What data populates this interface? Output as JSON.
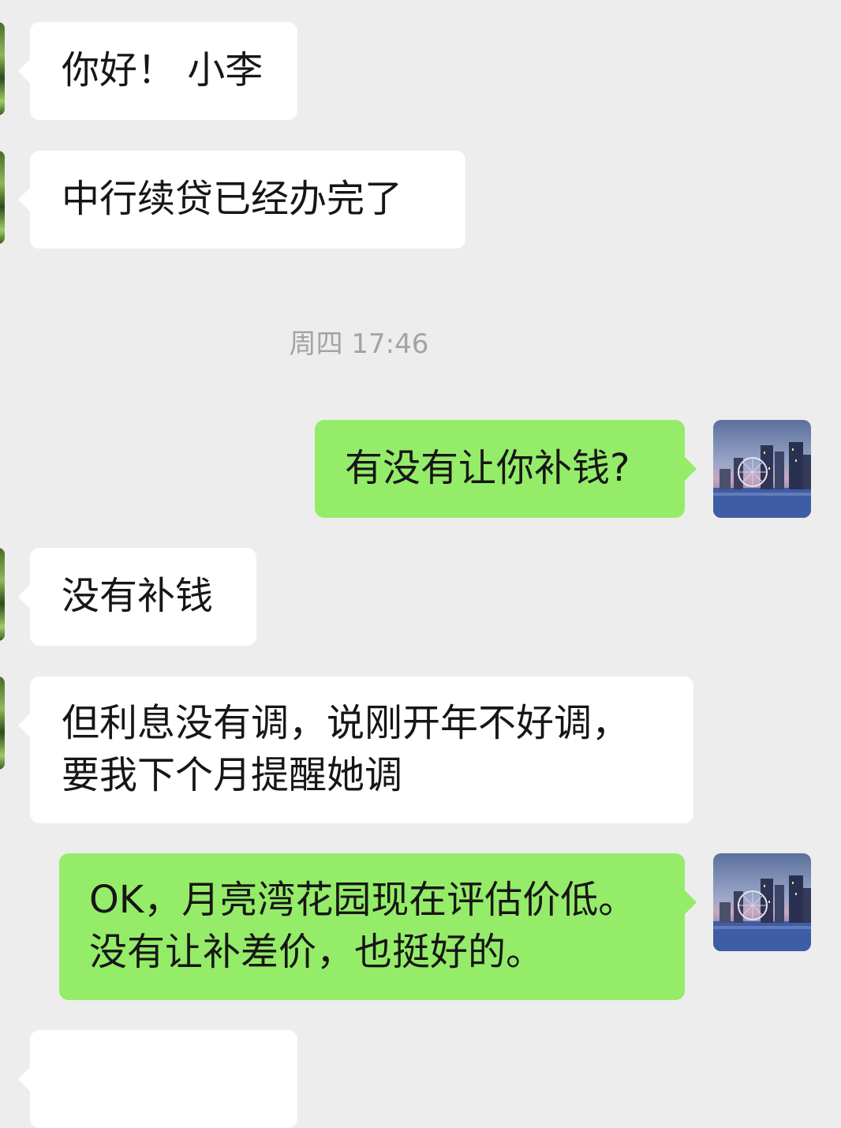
{
  "chat": {
    "timestamp": "周四 17:46",
    "messages": [
      {
        "side": "left",
        "lines": [
          "你好！ 小李"
        ]
      },
      {
        "side": "left",
        "lines": [
          "中行续贷已经办完了"
        ]
      },
      {
        "side": "right",
        "lines": [
          "有没有让你补钱?"
        ]
      },
      {
        "side": "left",
        "lines": [
          "没有补钱"
        ]
      },
      {
        "side": "left",
        "lines": [
          "但利息没有调，说刚开年不好调，",
          "要我下个月提醒她调"
        ]
      },
      {
        "side": "right",
        "lines": [
          "OK，月亮湾花园现在评估价低。",
          "没有让补差价，也挺好的。"
        ]
      },
      {
        "side": "left",
        "lines": [
          ""
        ]
      }
    ]
  },
  "colors": {
    "background": "#ededed",
    "incoming_bubble": "#ffffff",
    "outgoing_bubble": "#95ec69",
    "timestamp_text": "#a3a3a3"
  },
  "icons": {
    "contact_avatar": "avatar-photo-green",
    "my_avatar": "avatar-photo-ferris-wheel-city"
  }
}
